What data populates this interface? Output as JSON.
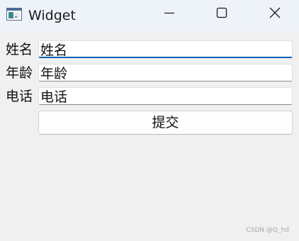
{
  "window": {
    "title": "Widget",
    "icon": "app-window-icon",
    "controls": [
      "minimize-icon",
      "maximize-icon",
      "close-icon"
    ]
  },
  "form": {
    "name_label": "姓名",
    "name_value": "姓名",
    "age_label": "年龄",
    "age_value": "年龄",
    "phone_label": "电话",
    "phone_value": "电话",
    "submit_label": "提交"
  },
  "watermark": "CSDN @Q_hd",
  "colors": {
    "focus_accent": "#005fb8",
    "background": "#f0f0f0",
    "titlebar": "#eef2f9"
  }
}
